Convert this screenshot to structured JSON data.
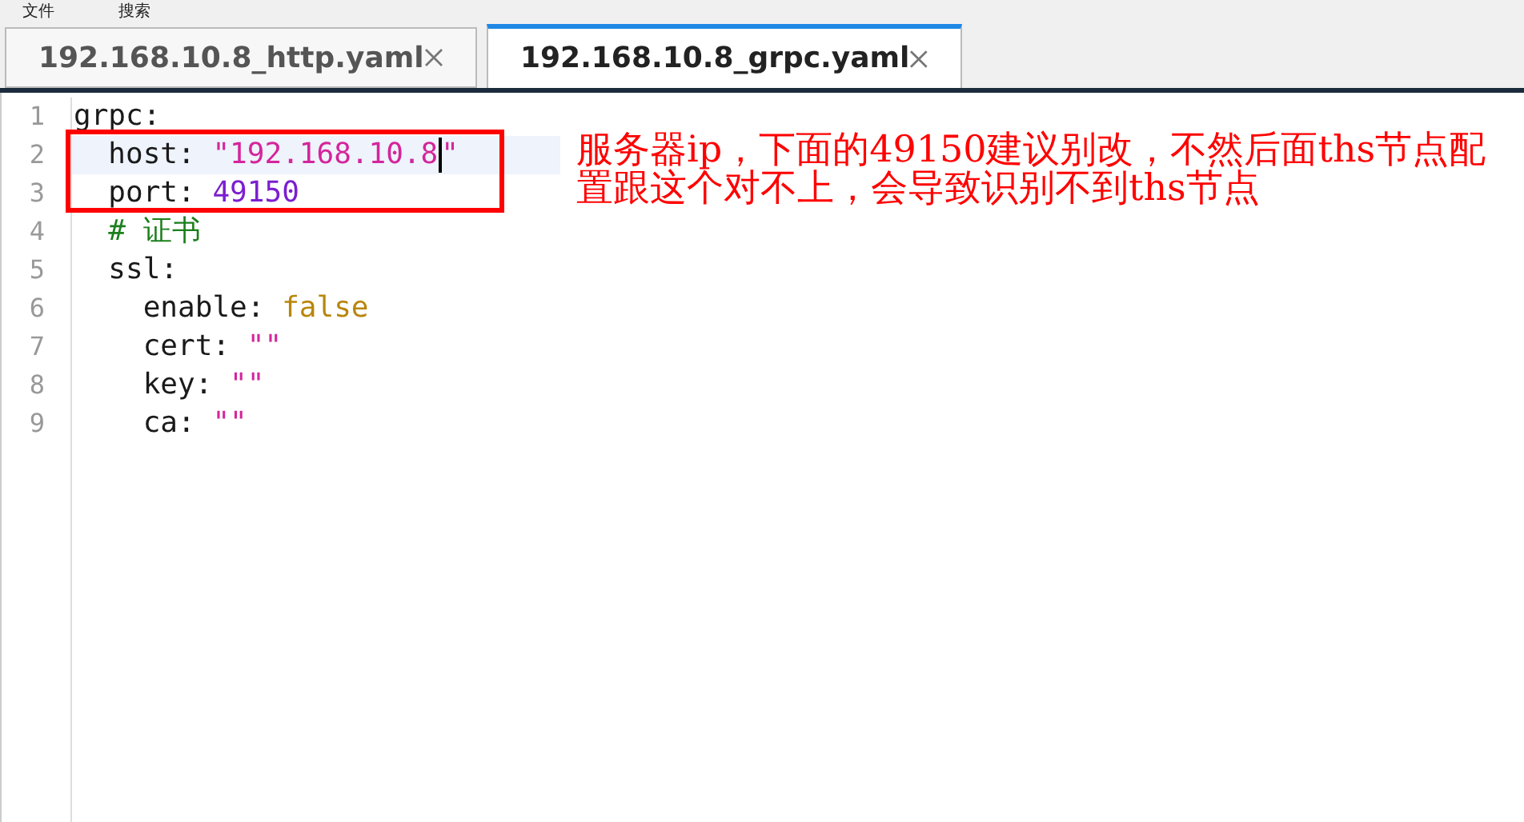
{
  "menu": [
    "文件",
    "搜索"
  ],
  "tabs": [
    {
      "label": "192.168.10.8_http.yaml",
      "selected": false
    },
    {
      "label": "192.168.10.8_grpc.yaml",
      "selected": true
    }
  ],
  "editor": {
    "lines": [
      {
        "number": "1",
        "current": false,
        "tokens": [
          {
            "kind": "key",
            "text": "grpc"
          },
          {
            "kind": "punct",
            "text": ":"
          }
        ]
      },
      {
        "number": "2",
        "current": true,
        "tokens": [
          {
            "kind": "key",
            "text": "  host"
          },
          {
            "kind": "punct",
            "text": ": "
          },
          {
            "kind": "string",
            "text": "\"192.168.10.8"
          },
          {
            "kind": "cursor"
          },
          {
            "kind": "string",
            "text": "\""
          }
        ]
      },
      {
        "number": "3",
        "current": false,
        "tokens": [
          {
            "kind": "key",
            "text": "  port"
          },
          {
            "kind": "punct",
            "text": ": "
          },
          {
            "kind": "number",
            "text": "49150"
          }
        ]
      },
      {
        "number": "4",
        "current": false,
        "tokens": [
          {
            "kind": "comment",
            "text": "  # 证书"
          }
        ]
      },
      {
        "number": "5",
        "current": false,
        "tokens": [
          {
            "kind": "key",
            "text": "  ssl"
          },
          {
            "kind": "punct",
            "text": ":"
          }
        ]
      },
      {
        "number": "6",
        "current": false,
        "tokens": [
          {
            "kind": "key",
            "text": "    enable"
          },
          {
            "kind": "punct",
            "text": ": "
          },
          {
            "kind": "bool",
            "text": "false"
          }
        ]
      },
      {
        "number": "7",
        "current": false,
        "tokens": [
          {
            "kind": "key",
            "text": "    cert"
          },
          {
            "kind": "punct",
            "text": ": "
          },
          {
            "kind": "string",
            "text": "\"\""
          }
        ]
      },
      {
        "number": "8",
        "current": false,
        "tokens": [
          {
            "kind": "key",
            "text": "    key"
          },
          {
            "kind": "punct",
            "text": ": "
          },
          {
            "kind": "string",
            "text": "\"\""
          }
        ]
      },
      {
        "number": "9",
        "current": false,
        "tokens": [
          {
            "kind": "key",
            "text": "    ca"
          },
          {
            "kind": "punct",
            "text": ": "
          },
          {
            "kind": "string",
            "text": "\"\""
          }
        ]
      }
    ]
  },
  "annotation": {
    "text": "服务器ip，下面的49150建议别改，不然后面ths节点配置跟这个对不上，会导致识别不到ths节点"
  }
}
